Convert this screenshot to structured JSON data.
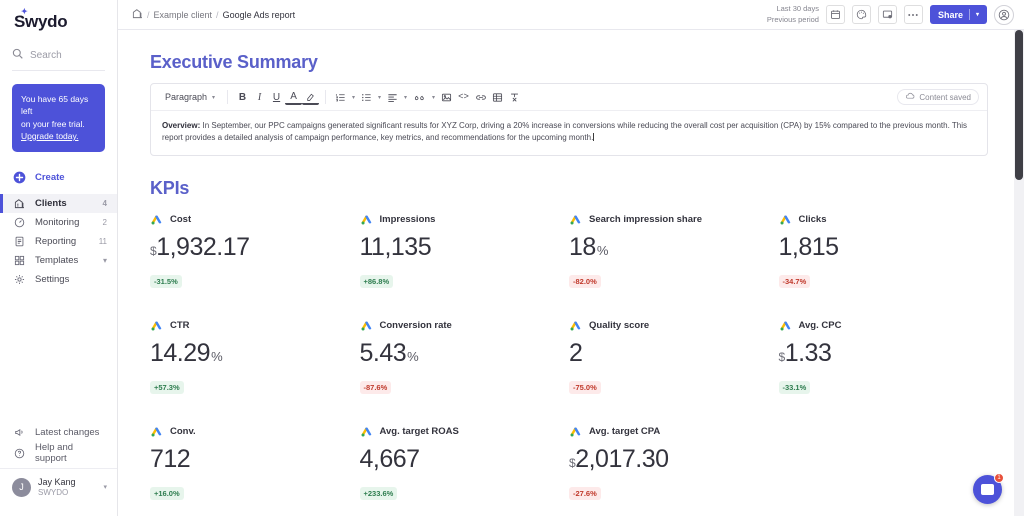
{
  "brand": {
    "logo_text": "Swydo",
    "accent": "#4d52d9"
  },
  "sidebar": {
    "search_placeholder": "Search",
    "trial": {
      "line1": "You have 65 days left",
      "line2": "on your free trial.",
      "link": "Upgrade today."
    },
    "create_label": "Create",
    "items": [
      {
        "label": "Clients",
        "count": "4",
        "icon": "clients-icon"
      },
      {
        "label": "Monitoring",
        "count": "2",
        "icon": "monitoring-icon"
      },
      {
        "label": "Reporting",
        "count": "11",
        "icon": "reporting-icon"
      },
      {
        "label": "Templates",
        "count": "",
        "icon": "templates-icon"
      },
      {
        "label": "Settings",
        "count": "",
        "icon": "settings-icon"
      }
    ],
    "bottom": [
      {
        "label": "Latest changes",
        "icon": "megaphone-icon"
      },
      {
        "label": "Help and support",
        "icon": "help-icon"
      }
    ],
    "user": {
      "initial": "J",
      "name": "Jay Kang",
      "org": "SWYDO"
    }
  },
  "topbar": {
    "breadcrumb": {
      "home_icon": "home-icon",
      "client": "Example client",
      "report": "Google Ads report",
      "separator": "/"
    },
    "daterange": {
      "primary": "Last 30 days",
      "secondary": "Previous period"
    },
    "share_label": "Share",
    "icons": [
      "calendar-icon",
      "palette-icon",
      "present-icon",
      "more-icon",
      "account-icon"
    ]
  },
  "report": {
    "section_title": "Executive Summary",
    "kpi_title": "KPIs",
    "editor": {
      "style_select": "Paragraph",
      "saved_label": "Content saved",
      "overview_label": "Overview:",
      "overview_text": " In September, our PPC campaigns generated significant results for XYZ Corp, driving a 20% increase in conversions while reducing the overall cost per acquisition (CPA) by 15% compared to the previous month. This report provides a detailed analysis of campaign performance, key metrics, and recommendations for the upcoming month."
    }
  },
  "chart_data": {
    "type": "table",
    "title": "KPIs",
    "columns": [
      "metric",
      "value",
      "change"
    ],
    "kpis": [
      {
        "name": "Cost",
        "symbol": "$",
        "value": "1,932.17",
        "unit": "",
        "change": "-31.5%",
        "direction": "up"
      },
      {
        "name": "Impressions",
        "symbol": "",
        "value": "11,135",
        "unit": "",
        "change": "+86.8%",
        "direction": "up"
      },
      {
        "name": "Search impression share",
        "symbol": "",
        "value": "18",
        "unit": "%",
        "change": "-82.0%",
        "direction": "down"
      },
      {
        "name": "Clicks",
        "symbol": "",
        "value": "1,815",
        "unit": "",
        "change": "-34.7%",
        "direction": "down"
      },
      {
        "name": "CTR",
        "symbol": "",
        "value": "14.29",
        "unit": "%",
        "change": "+57.3%",
        "direction": "up"
      },
      {
        "name": "Conversion rate",
        "symbol": "",
        "value": "5.43",
        "unit": "%",
        "change": "-87.6%",
        "direction": "down"
      },
      {
        "name": "Quality score",
        "symbol": "",
        "value": "2",
        "unit": "",
        "change": "-75.0%",
        "direction": "down"
      },
      {
        "name": "Avg. CPC",
        "symbol": "$",
        "value": "1.33",
        "unit": "",
        "change": "-33.1%",
        "direction": "up"
      },
      {
        "name": "Conv.",
        "symbol": "",
        "value": "712",
        "unit": "",
        "change": "+16.0%",
        "direction": "up"
      },
      {
        "name": "Avg. target ROAS",
        "symbol": "",
        "value": "4,667",
        "unit": "",
        "change": "+233.6%",
        "direction": "up"
      },
      {
        "name": "Avg. target CPA",
        "symbol": "$",
        "value": "2,017.30",
        "unit": "",
        "change": "-27.6%",
        "direction": "down"
      }
    ],
    "colors": {
      "positive": "#2e7d4f",
      "negative": "#c0392b",
      "accent": "#4d52d9"
    }
  },
  "chat": {
    "badge": "1",
    "icon": "chat-icon"
  }
}
